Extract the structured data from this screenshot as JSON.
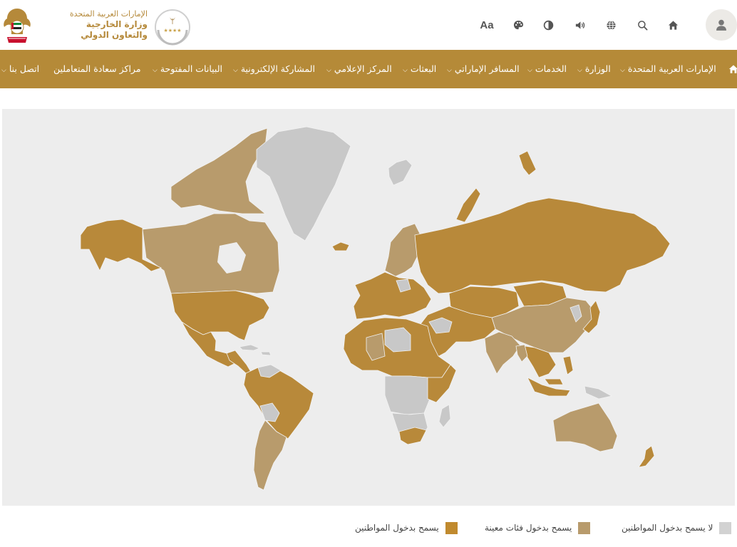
{
  "branding": {
    "line1": "الإمارات العربية المتحدة",
    "line2": "وزارة الخارجية",
    "line3": "والتعاون الدولي",
    "seal_rating": "★★★★"
  },
  "toolbar": {
    "font_size_label": "Aa",
    "icons": [
      "home-icon",
      "search-icon",
      "globe-icon",
      "speaker-icon",
      "contrast-icon",
      "palette-icon",
      "user-icon"
    ]
  },
  "nav": {
    "items": [
      {
        "label": "الإمارات العربية المتحدة",
        "dropdown": true
      },
      {
        "label": "الوزارة",
        "dropdown": true
      },
      {
        "label": "الخدمات",
        "dropdown": true
      },
      {
        "label": "المسافر الإماراتي",
        "dropdown": true
      },
      {
        "label": "البعثات",
        "dropdown": true
      },
      {
        "label": "المركز الإعلامي",
        "dropdown": true
      },
      {
        "label": "المشاركة الإلكترونية",
        "dropdown": true
      },
      {
        "label": "البيانات المفتوحة",
        "dropdown": true
      },
      {
        "label": "مراكز سعادة المتعاملين",
        "dropdown": false
      },
      {
        "label": "اتصل بنا",
        "dropdown": true
      }
    ]
  },
  "map": {
    "colors": {
      "allowed": "#b8893a",
      "restricted": "#b89b6c",
      "not_allowed": "#c8c8c8",
      "background": "#ededed"
    }
  },
  "legend": {
    "not_allowed": "لا يسمح بدخول المواطنين",
    "restricted": "يسمح بدخول فئات معينة",
    "allowed": "يسمح بدخول المواطنين"
  },
  "colors": {
    "brand_gold": "#b58a38",
    "nav_text": "#ffffff"
  }
}
